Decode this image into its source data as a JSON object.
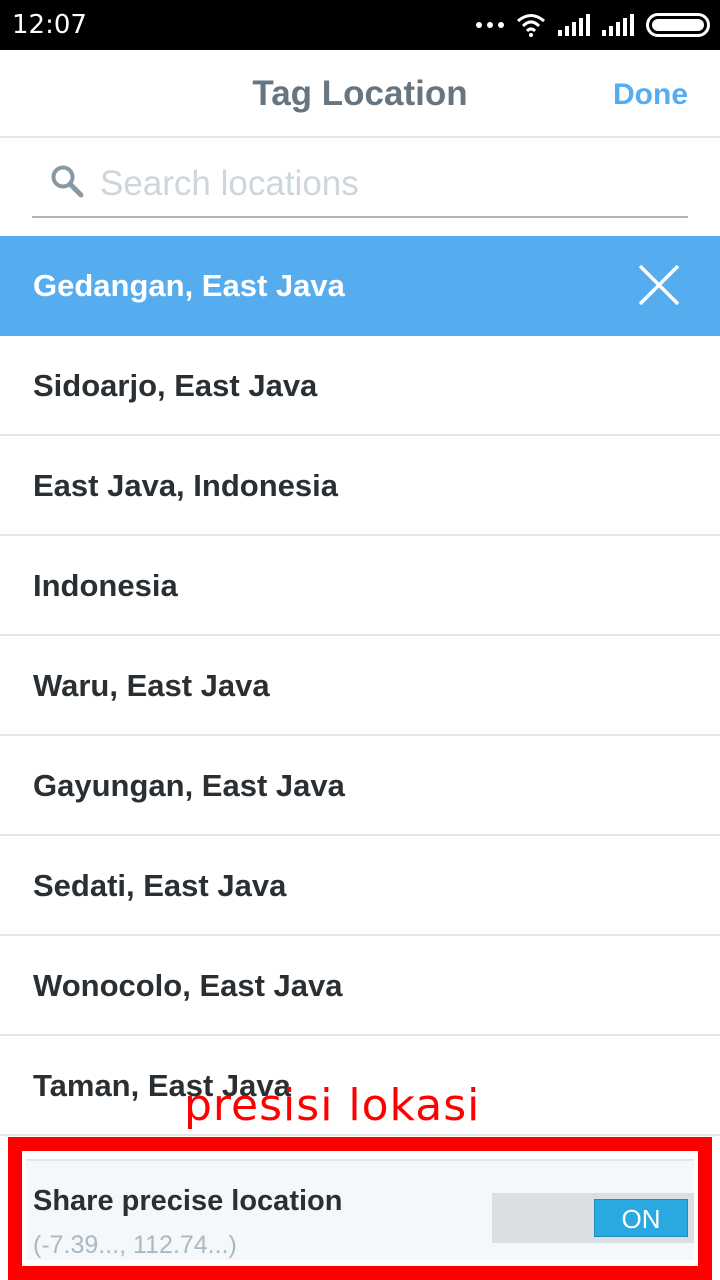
{
  "status_bar": {
    "time": "12:07"
  },
  "header": {
    "title": "Tag Location",
    "done_label": "Done"
  },
  "search": {
    "placeholder": "Search locations",
    "value": ""
  },
  "locations": [
    {
      "label": "Gedangan, East Java",
      "selected": true
    },
    {
      "label": "Sidoarjo, East Java"
    },
    {
      "label": "East Java, Indonesia"
    },
    {
      "label": "Indonesia"
    },
    {
      "label": "Waru, East Java"
    },
    {
      "label": "Gayungan, East Java"
    },
    {
      "label": "Sedati, East Java"
    },
    {
      "label": "Wonocolo, East Java"
    },
    {
      "label": "Taman, East Java"
    }
  ],
  "annotation": "presisi lokasi",
  "precise_location": {
    "title": "Share precise location",
    "coords": "(-7.39..., 112.74...)",
    "toggle_label": "ON",
    "enabled": true
  },
  "colors": {
    "accent": "#55acee",
    "annotation": "#ff0000",
    "toggle_on": "#2aa9e0"
  }
}
